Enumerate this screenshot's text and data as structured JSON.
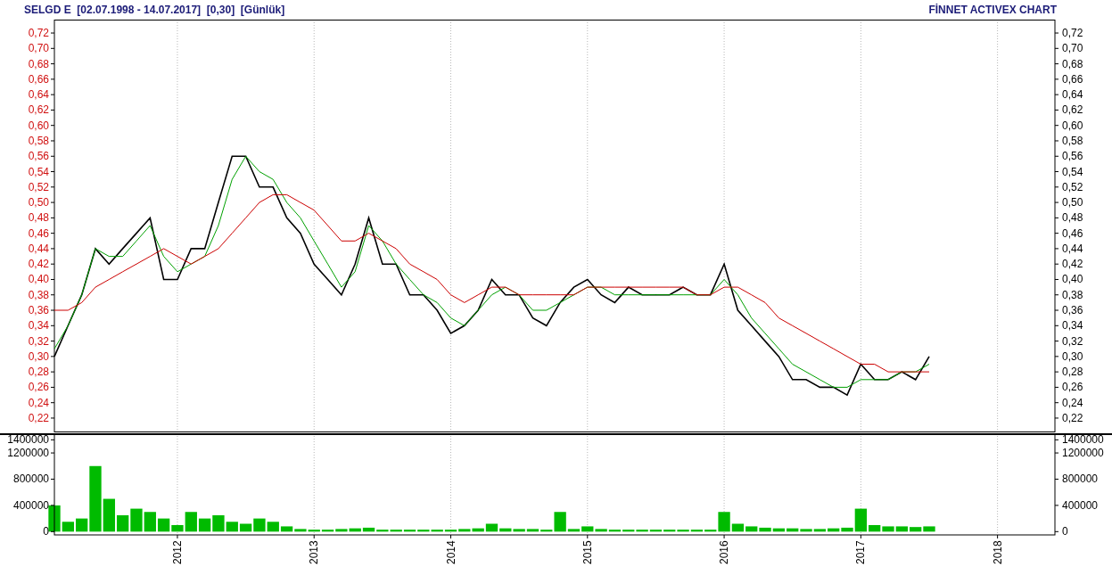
{
  "header": {
    "title": "SELGD E  [02.07.1998 - 14.07.2017]  [0,30]  [Günlük]",
    "brand": "FİNNET ACTIVEX CHART"
  },
  "price_panel": {
    "chart_data": {
      "type": "line",
      "x": [
        2011.1,
        2011.2,
        2011.3,
        2011.4,
        2011.5,
        2011.6,
        2011.7,
        2011.8,
        2011.9,
        2012.0,
        2012.1,
        2012.2,
        2012.3,
        2012.4,
        2012.5,
        2012.6,
        2012.7,
        2012.8,
        2012.9,
        2013.0,
        2013.1,
        2013.2,
        2013.3,
        2013.4,
        2013.5,
        2013.6,
        2013.7,
        2013.8,
        2013.9,
        2014.0,
        2014.1,
        2014.2,
        2014.3,
        2014.4,
        2014.5,
        2014.6,
        2014.7,
        2014.8,
        2014.9,
        2015.0,
        2015.1,
        2015.2,
        2015.3,
        2015.4,
        2015.5,
        2015.6,
        2015.7,
        2015.8,
        2015.9,
        2016.0,
        2016.1,
        2016.2,
        2016.3,
        2016.4,
        2016.5,
        2016.6,
        2016.7,
        2016.8,
        2016.9,
        2017.0,
        2017.1,
        2017.2,
        2017.3,
        2017.4,
        2017.5
      ],
      "xlim": [
        2011.1,
        2018.42
      ],
      "ylim": [
        0.2026,
        0.7374
      ],
      "grid": true,
      "yticks": [
        {
          "value": 0.72,
          "label": "0,72"
        },
        {
          "value": 0.7,
          "label": "0,70"
        },
        {
          "value": 0.68,
          "label": "0,68"
        },
        {
          "value": 0.66,
          "label": "0,66"
        },
        {
          "value": 0.64,
          "label": "0,64"
        },
        {
          "value": 0.62,
          "label": "0,62"
        },
        {
          "value": 0.6,
          "label": "0,60"
        },
        {
          "value": 0.58,
          "label": "0,58"
        },
        {
          "value": 0.56,
          "label": "0,56"
        },
        {
          "value": 0.54,
          "label": "0,54"
        },
        {
          "value": 0.52,
          "label": "0,52"
        },
        {
          "value": 0.5,
          "label": "0,50"
        },
        {
          "value": 0.48,
          "label": "0,48"
        },
        {
          "value": 0.46,
          "label": "0,46"
        },
        {
          "value": 0.44,
          "label": "0,44"
        },
        {
          "value": 0.42,
          "label": "0,42"
        },
        {
          "value": 0.4,
          "label": "0,40"
        },
        {
          "value": 0.38,
          "label": "0,38"
        },
        {
          "value": 0.36,
          "label": "0,36"
        },
        {
          "value": 0.34,
          "label": "0,34"
        },
        {
          "value": 0.32,
          "label": "0,32"
        },
        {
          "value": 0.3,
          "label": "0,30"
        },
        {
          "value": 0.28,
          "label": "0,28"
        },
        {
          "value": 0.26,
          "label": "0,26"
        },
        {
          "value": 0.24,
          "label": "0,24"
        },
        {
          "value": 0.22,
          "label": "0,22"
        }
      ],
      "series": [
        {
          "color": "#000000",
          "values": [
            0.3,
            0.34,
            0.38,
            0.44,
            0.42,
            0.44,
            0.46,
            0.48,
            0.4,
            0.4,
            0.44,
            0.44,
            0.5,
            0.56,
            0.56,
            0.52,
            0.52,
            0.48,
            0.46,
            0.42,
            0.4,
            0.38,
            0.42,
            0.48,
            0.42,
            0.42,
            0.38,
            0.38,
            0.36,
            0.33,
            0.34,
            0.36,
            0.4,
            0.38,
            0.38,
            0.35,
            0.34,
            0.37,
            0.39,
            0.4,
            0.38,
            0.37,
            0.39,
            0.38,
            0.38,
            0.38,
            0.39,
            0.38,
            0.38,
            0.42,
            0.36,
            0.34,
            0.32,
            0.3,
            0.27,
            0.27,
            0.26,
            0.26,
            0.25,
            0.29,
            0.27,
            0.27,
            0.28,
            0.27,
            0.3
          ]
        },
        {
          "color": "#00a000",
          "values": [
            0.31,
            0.34,
            0.38,
            0.44,
            0.43,
            0.43,
            0.45,
            0.47,
            0.43,
            0.41,
            0.42,
            0.43,
            0.47,
            0.53,
            0.56,
            0.54,
            0.53,
            0.5,
            0.48,
            0.45,
            0.42,
            0.39,
            0.41,
            0.47,
            0.45,
            0.42,
            0.4,
            0.38,
            0.37,
            0.35,
            0.34,
            0.36,
            0.38,
            0.39,
            0.38,
            0.36,
            0.36,
            0.37,
            0.38,
            0.39,
            0.39,
            0.38,
            0.38,
            0.38,
            0.38,
            0.38,
            0.38,
            0.38,
            0.38,
            0.4,
            0.38,
            0.35,
            0.33,
            0.31,
            0.29,
            0.28,
            0.27,
            0.26,
            0.26,
            0.27,
            0.27,
            0.27,
            0.28,
            0.28,
            0.29
          ]
        },
        {
          "color": "#cc0000",
          "values": [
            0.36,
            0.36,
            0.37,
            0.39,
            0.4,
            0.41,
            0.42,
            0.43,
            0.44,
            0.43,
            0.42,
            0.43,
            0.44,
            0.46,
            0.48,
            0.5,
            0.51,
            0.51,
            0.5,
            0.49,
            0.47,
            0.45,
            0.45,
            0.46,
            0.45,
            0.44,
            0.42,
            0.41,
            0.4,
            0.38,
            0.37,
            0.38,
            0.39,
            0.39,
            0.38,
            0.38,
            0.38,
            0.38,
            0.38,
            0.39,
            0.39,
            0.39,
            0.39,
            0.39,
            0.39,
            0.39,
            0.39,
            0.38,
            0.38,
            0.39,
            0.39,
            0.38,
            0.37,
            0.35,
            0.34,
            0.33,
            0.32,
            0.31,
            0.3,
            0.29,
            0.29,
            0.28,
            0.28,
            0.28,
            0.28
          ]
        }
      ]
    }
  },
  "volume_panel": {
    "chart_data": {
      "type": "bar",
      "x": [
        2011.1,
        2011.2,
        2011.3,
        2011.4,
        2011.5,
        2011.6,
        2011.7,
        2011.8,
        2011.9,
        2012.0,
        2012.1,
        2012.2,
        2012.3,
        2012.4,
        2012.5,
        2012.6,
        2012.7,
        2012.8,
        2012.9,
        2013.0,
        2013.1,
        2013.2,
        2013.3,
        2013.4,
        2013.5,
        2013.6,
        2013.7,
        2013.8,
        2013.9,
        2014.0,
        2014.1,
        2014.2,
        2014.3,
        2014.4,
        2014.5,
        2014.6,
        2014.7,
        2014.8,
        2014.9,
        2015.0,
        2015.1,
        2015.2,
        2015.3,
        2015.4,
        2015.5,
        2015.6,
        2015.7,
        2015.8,
        2015.9,
        2016.0,
        2016.1,
        2016.2,
        2016.3,
        2016.4,
        2016.5,
        2016.6,
        2016.7,
        2016.8,
        2016.9,
        2017.0,
        2017.1,
        2017.2,
        2017.3,
        2017.4,
        2017.5
      ],
      "xlim": [
        2011.1,
        2018.42
      ],
      "ylim": [
        -50000,
        1500000
      ],
      "xticks": [
        2012,
        2013,
        2014,
        2015,
        2016,
        2017,
        2018
      ],
      "yticks": [
        {
          "value": 1400000,
          "label": "1400000"
        },
        {
          "value": 1200000,
          "label": "1200000"
        },
        {
          "value": 800000,
          "label": "800000"
        },
        {
          "value": 400000,
          "label": "400000"
        },
        {
          "value": 0,
          "label": "0"
        }
      ],
      "grid": true,
      "series": [
        {
          "color": "#00bb00",
          "values": [
            400000,
            150000,
            200000,
            1000000,
            500000,
            250000,
            350000,
            300000,
            200000,
            100000,
            300000,
            200000,
            250000,
            150000,
            120000,
            200000,
            150000,
            80000,
            40000,
            30000,
            30000,
            40000,
            50000,
            60000,
            30000,
            30000,
            30000,
            30000,
            30000,
            30000,
            40000,
            50000,
            120000,
            50000,
            40000,
            40000,
            30000,
            300000,
            40000,
            80000,
            40000,
            30000,
            30000,
            30000,
            30000,
            30000,
            30000,
            30000,
            30000,
            300000,
            120000,
            80000,
            60000,
            50000,
            50000,
            40000,
            40000,
            50000,
            60000,
            350000,
            100000,
            80000,
            80000,
            70000,
            80000
          ]
        }
      ]
    }
  }
}
